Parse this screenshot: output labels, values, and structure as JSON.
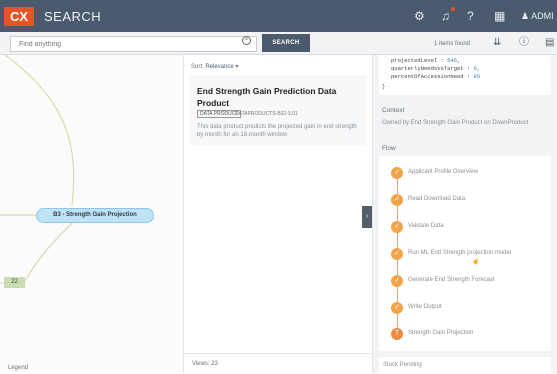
{
  "header": {
    "logo": "CX",
    "title": "SEARCH",
    "user_label": "ADMI"
  },
  "search": {
    "placeholder": "Find anything",
    "button_label": "SEARCH",
    "items_found": "1 items found"
  },
  "graph": {
    "node_label": "B3 - Strength Gain Projection",
    "tag_label": "22",
    "legend_label": "Legend"
  },
  "results": {
    "sort_label": "Sort:",
    "sort_value": "Relevance",
    "item": {
      "title": "End Strength Gain Prediction Data Product",
      "badge": "DATA PRODUCT",
      "id_text": "DATAPRODUCTS-B32-3.01",
      "description": "This data product predicts the projected gain in end strength by month for an 18-month window"
    },
    "views_label": "Views:",
    "views_count": "23"
  },
  "detail": {
    "code_lines": [
      {
        "key": "projectedLevel",
        "value": "546"
      },
      {
        "key": "quarterlyNeedsVsTarget",
        "value": "0"
      },
      {
        "key": "percentOfAccessionNeed",
        "value": "85"
      }
    ],
    "code_closing": "}",
    "context_title": "Context",
    "context_text": "Owned by End Strength Gain Product on DownProduct",
    "flow_title": "Flow",
    "flow_steps": [
      {
        "label": "Applicant Profile Overview",
        "icon": "check"
      },
      {
        "label": "Read Download Data",
        "icon": "check"
      },
      {
        "label": "Validate Data",
        "icon": "check"
      },
      {
        "label": "Run ML End Strength projection model",
        "icon": "check"
      },
      {
        "label": "Generate End Strength Forecast",
        "icon": "check"
      },
      {
        "label": "Write Output",
        "icon": "check"
      },
      {
        "label": "Strength Gain Projection",
        "icon": "target"
      }
    ],
    "bottom_section": "Stock Pending"
  },
  "colors": {
    "topbar": "#4b5a6e",
    "accent": "#e8542a",
    "flow_step": "#f2a44a",
    "node_fill": "#bfe2f6"
  }
}
